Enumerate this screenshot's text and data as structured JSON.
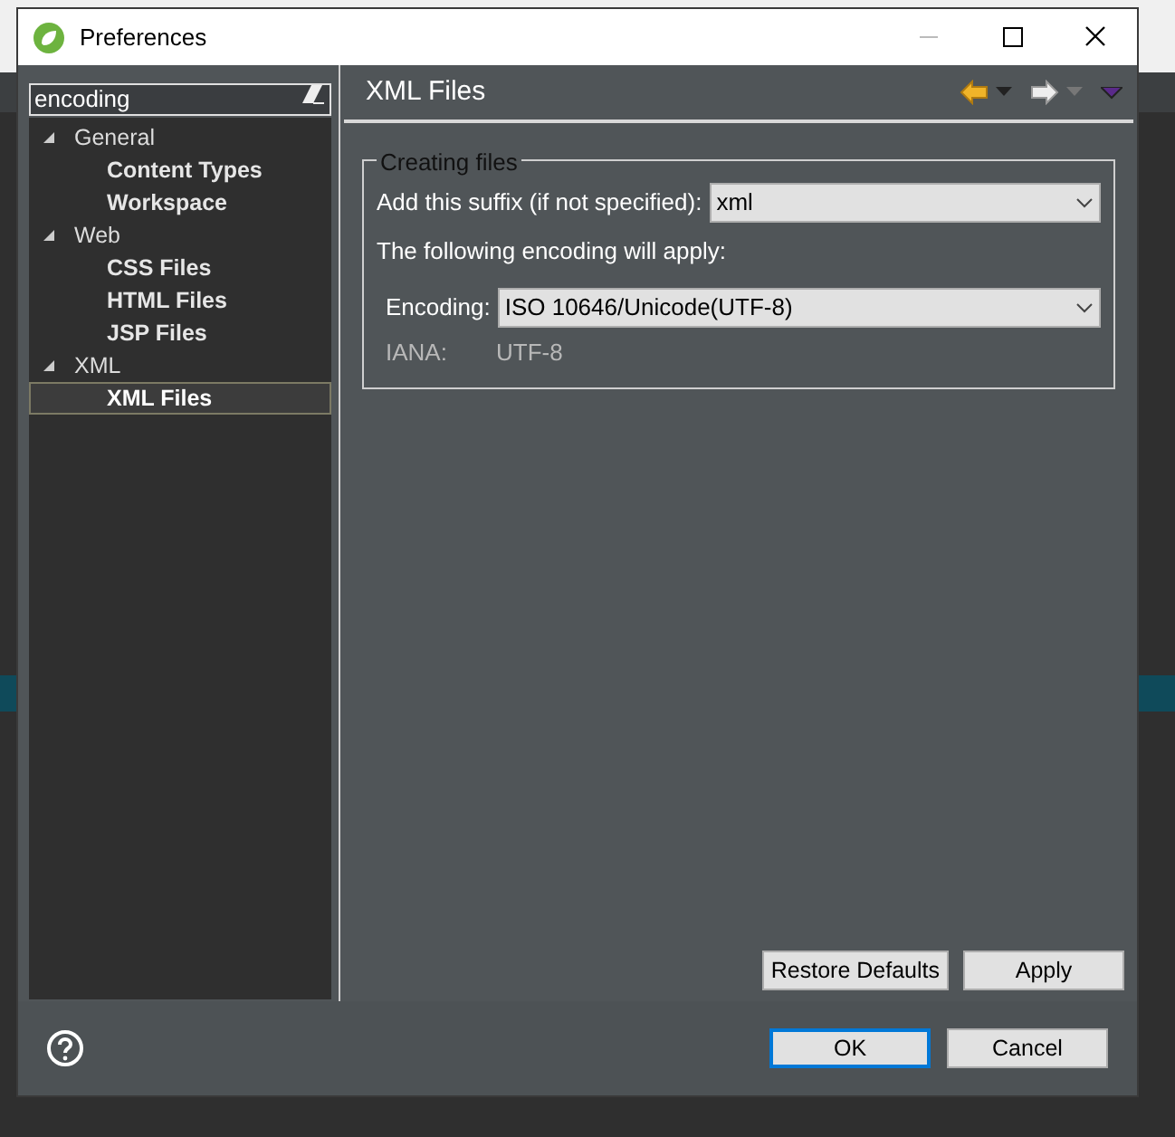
{
  "window": {
    "title": "Preferences"
  },
  "filter": {
    "value": "encoding"
  },
  "tree": [
    {
      "label": "General",
      "expanded": true,
      "selected": false,
      "children": [
        {
          "label": "Content Types",
          "selected": false
        },
        {
          "label": "Workspace",
          "selected": false
        }
      ]
    },
    {
      "label": "Web",
      "expanded": true,
      "selected": false,
      "children": [
        {
          "label": "CSS Files",
          "selected": false
        },
        {
          "label": "HTML Files",
          "selected": false
        },
        {
          "label": "JSP Files",
          "selected": false
        }
      ]
    },
    {
      "label": "XML",
      "expanded": true,
      "selected": false,
      "children": [
        {
          "label": "XML Files",
          "selected": true
        }
      ]
    }
  ],
  "page": {
    "title": "XML Files",
    "group": {
      "title": "Creating files",
      "suffix": {
        "label": "Add this suffix (if not specified):",
        "value": "xml"
      },
      "note": "The following encoding will apply:",
      "encoding": {
        "label": "Encoding:",
        "value": "ISO 10646/Unicode(UTF-8)"
      },
      "iana": {
        "label": "IANA:",
        "value": "UTF-8"
      }
    },
    "buttons": [
      "Restore Defaults",
      "Apply"
    ]
  },
  "footer_buttons": [
    {
      "label": "OK",
      "default": true
    },
    {
      "label": "Cancel",
      "default": false
    }
  ]
}
